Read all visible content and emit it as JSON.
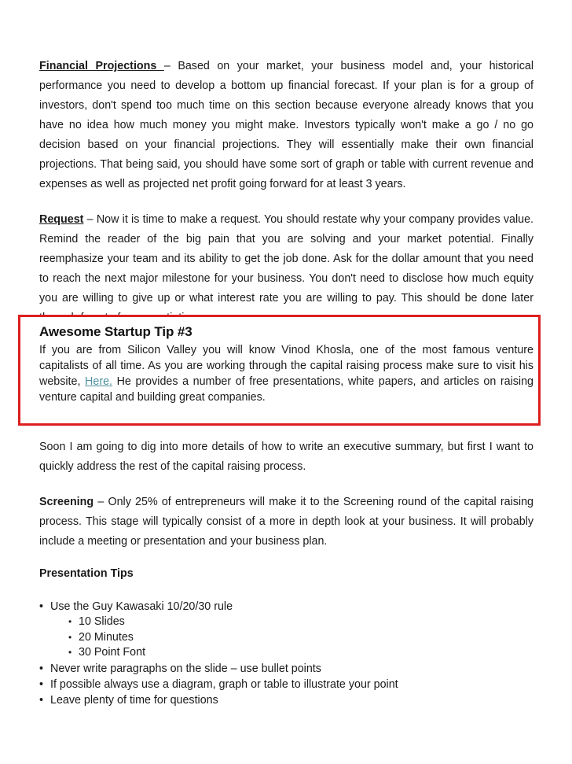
{
  "document": {
    "background_color": "#ffffff",
    "text_color": "#1a1a1a",
    "accent_color": "#dd1f1f",
    "link_color": "#4d8f9c"
  },
  "sections": {
    "financial_projections": {
      "lead": "Financial Projections ",
      "dash": "– ",
      "body": "Based on your market, your business model and, your historical performance you need to develop a bottom up financial forecast.  If your plan is for a group of investors, don't spend too much time on this section because everyone already knows that you have no idea how much money you might make.  Investors typically won't make a go / no go decision based on your financial projections.  They will essentially make their own financial projections.  That being said, you should have some sort of graph or table with current revenue and expenses as well as projected net profit going forward for at least 3 years."
    },
    "request": {
      "lead": "Request",
      "dash": " – ",
      "body": "Now it is time to make a request.  You should restate why your company provides value.    Remind the reader of the big pain that you are solving and your market potential.  Finally reemphasize your team and its ability to get the job done.  Ask for the dollar amount that you need to reach the next major milestone for your business.  You don't need to disclose how much equity you are willing to give up or what interest rate you are willing to pay.  This should be done later through face to face negotiation."
    },
    "tip_box": {
      "title": "Awesome Startup Tip #3",
      "text_before_link": "If you are from Silicon Valley you will know Vinod Khosla, one of the most famous venture capitalists of all time.  As you are working through the capital raising process make sure to visit his website, ",
      "link_label": "Here.",
      "text_after_link": "  He provides a number of free presentations, white papers, and articles on raising venture capital and building great companies."
    },
    "transition": {
      "body": "Soon I am going to dig into more details of how to write an executive summary, but first I want to quickly address the rest of the capital raising process."
    },
    "screening": {
      "lead": "Screening",
      "dash": " – ",
      "body": "Only 25% of entrepreneurs will make it to the Screening round of the capital raising process.   This stage will typically consist of a more in depth look at your business.  It will probably include a meeting or presentation and your business plan."
    },
    "presentation_tips": {
      "heading": "Presentation Tips",
      "bullet_glyph": "•",
      "sub_bullet_glyph": "•",
      "items": [
        {
          "label": "Use the Guy Kawasaki 10/20/30 rule",
          "sub_items": [
            "10 Slides",
            "20 Minutes",
            "30 Point Font"
          ]
        },
        {
          "label": "Never write paragraphs on the slide – use bullet points",
          "sub_items": []
        },
        {
          "label": "If possible always use a diagram, graph or table to illustrate your point",
          "sub_items": []
        },
        {
          "label": "Leave plenty of time for questions",
          "sub_items": []
        }
      ]
    }
  }
}
